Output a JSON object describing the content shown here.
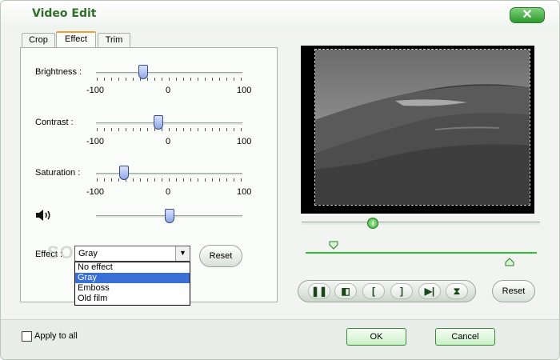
{
  "window": {
    "title": "Video Edit",
    "close_label": "✕"
  },
  "tabs": [
    {
      "label": "Crop"
    },
    {
      "label": "Effect"
    },
    {
      "label": "Trim"
    }
  ],
  "sliders": {
    "brightness": {
      "label": "Brightness :",
      "min": "-100",
      "mid": "0",
      "max": "100",
      "value": -35
    },
    "contrast": {
      "label": "Contrast :",
      "min": "-100",
      "mid": "0",
      "max": "100",
      "value": -15
    },
    "saturation": {
      "label": "Saturation :",
      "min": "-100",
      "mid": "0",
      "max": "100",
      "value": -62
    },
    "volume": {
      "icon": "speaker-icon",
      "level": 0.5
    }
  },
  "effect": {
    "label": "Effect :",
    "selected": "Gray",
    "options": [
      "No effect",
      "Gray",
      "Emboss",
      "Old film"
    ],
    "reset_label": "Reset"
  },
  "player": {
    "position": 0.3,
    "trim_start": 0.1,
    "trim_end": 0.86,
    "controls": [
      {
        "name": "pause-icon",
        "glyph": "❚❚"
      },
      {
        "name": "snapshot-icon",
        "glyph": "◧"
      },
      {
        "name": "mark-in-icon",
        "glyph": "["
      },
      {
        "name": "mark-out-icon",
        "glyph": "]"
      },
      {
        "name": "next-frame-icon",
        "glyph": "▶|"
      },
      {
        "name": "split-icon",
        "glyph": "⧗"
      }
    ],
    "reset_label": "Reset"
  },
  "footer": {
    "apply_all_label": "Apply to all",
    "ok_label": "OK",
    "cancel_label": "Cancel"
  },
  "watermark": "SOFTPEDIA",
  "colors": {
    "accent": "#2e9a2e",
    "title": "#2f6f2a",
    "selection": "#3a6fd8"
  }
}
